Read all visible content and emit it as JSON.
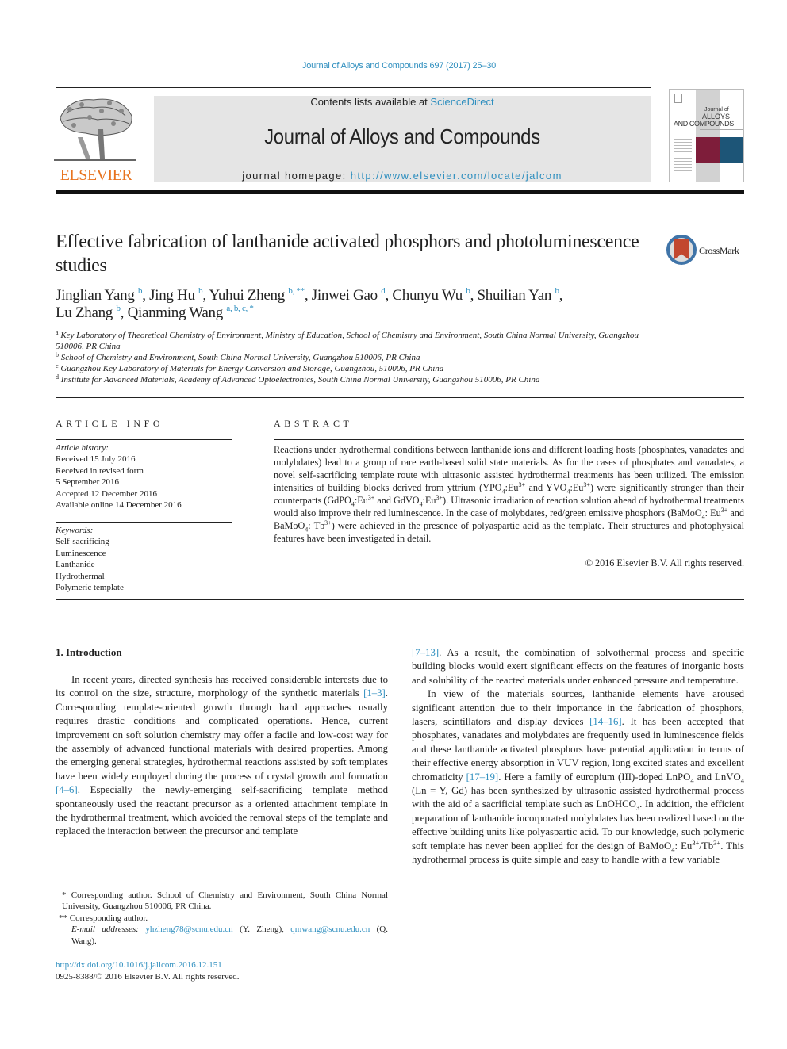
{
  "header": {
    "citation": "Journal of Alloys and Compounds 697 (2017) 25–30",
    "contents_prefix": "Contents lists available at ",
    "contents_link": "ScienceDirect",
    "journal_title": "Journal of Alloys and Compounds",
    "homepage_prefix": "journal homepage: ",
    "homepage_link": "http://www.elsevier.com/locate/jalcom",
    "publisher_logo_text": "ELSEVIER",
    "cover": {
      "title_line1": "Journal of",
      "title_line2": "ALLOYS",
      "title_line3": "AND COMPOUNDS"
    },
    "brand_colors": {
      "link": "#2f8fbf",
      "elsevier_orange": "#e8731e",
      "cover_red": "#7e1d3a",
      "cover_blue": "#1d5577"
    }
  },
  "article": {
    "title": "Effective fabrication of lanthanide activated phosphors and photoluminescence studies",
    "crossmark_label": "CrossMark",
    "authors": [
      {
        "name": "Jinglian Yang",
        "marks": "b"
      },
      {
        "name": "Jing Hu",
        "marks": "b"
      },
      {
        "name": "Yuhui Zheng",
        "marks": "b, **"
      },
      {
        "name": "Jinwei Gao",
        "marks": "d"
      },
      {
        "name": "Chunyu Wu",
        "marks": "b"
      },
      {
        "name": "Shuilian Yan",
        "marks": "b"
      },
      {
        "name": "Lu Zhang",
        "marks": "b"
      },
      {
        "name": "Qianming Wang",
        "marks": "a, b, c, *"
      }
    ],
    "affiliations": [
      {
        "mark": "a",
        "text": "Key Laboratory of Theoretical Chemistry of Environment, Ministry of Education, School of Chemistry and Environment, South China Normal University, Guangzhou 510006, PR China"
      },
      {
        "mark": "b",
        "text": "School of Chemistry and Environment, South China Normal University, Guangzhou 510006, PR China"
      },
      {
        "mark": "c",
        "text": "Guangzhou Key Laboratory of Materials for Energy Conversion and Storage, Guangzhou, 510006, PR China"
      },
      {
        "mark": "d",
        "text": "Institute for Advanced Materials, Academy of Advanced Optoelectronics, South China Normal University, Guangzhou 510006, PR China"
      }
    ]
  },
  "article_info": {
    "heading": "ARTICLE INFO",
    "history_label": "Article history:",
    "history": [
      "Received 15 July 2016",
      "Received in revised form",
      "5 September 2016",
      "Accepted 12 December 2016",
      "Available online 14 December 2016"
    ],
    "keywords_label": "Keywords:",
    "keywords": [
      "Self-sacrificing",
      "Luminescence",
      "Lanthanide",
      "Hydrothermal",
      "Polymeric template"
    ]
  },
  "abstract": {
    "heading": "ABSTRACT",
    "s1": "Reactions under hydrothermal conditions between lanthanide ions and different loading hosts (phosphates, vanadates and molybdates) lead to a group of rare earth-based solid state materials. As for the cases of phosphates and vanadates, a novel self-sacrificing template route with ultrasonic assisted hydrothermal treatments has been utilized. The emission intensities of building blocks derived from yttrium (YPO",
    "s2": ":Eu",
    "s3": " and YVO",
    "s4": ":Eu",
    "s5": ") were significantly stronger than their counterparts (GdPO",
    "s6": ":Eu",
    "s7": " and GdVO",
    "s8": ":Eu",
    "s9": "). Ultrasonic irradiation of reaction solution ahead of hydrothermal treatments would also improve their red luminescence. In the case of molybdates, red/green emissive phosphors (BaMoO",
    "s10": ": Eu",
    "s11": " and BaMoO",
    "s12": ": Tb",
    "s13": ") were achieved in the presence of polyaspartic acid as the template. Their structures and photophysical features have been investigated in detail.",
    "sub4": "4",
    "sup3": "3+",
    "copyright": "© 2016 Elsevier B.V. All rights reserved."
  },
  "body": {
    "intro_heading": "1.  Introduction",
    "p1_a": "In recent years, directed synthesis has received considerable interests due to its control on the size, structure, morphology of the synthetic materials ",
    "p1_ref1": "[1–3]",
    "p1_b": ". Corresponding template-oriented growth through hard approaches usually requires drastic conditions and complicated operations. Hence, current improvement on soft solution chemistry may offer a facile and low-cost way for the assembly of advanced functional materials with desired properties. Among the emerging general strategies, hydrothermal reactions assisted by soft templates have been widely employed during the process of crystal growth and formation ",
    "p1_ref2": "[4–6]",
    "p1_c": ". Especially the newly-emerging self-sacrificing template method spontaneously used the reactant precursor as a oriented attachment template in the hydrothermal treatment, which avoided the removal steps of the template and replaced the interaction between the precursor and template ",
    "p1_ref3": "[7–13]",
    "p1_d": ". As a result, the combination of solvothermal process and specific building blocks would exert significant effects on the features of inorganic hosts and solubility of the reacted materials under enhanced pressure and temperature.",
    "p2_a": "In view of the materials sources, lanthanide elements have aroused significant attention due to their importance in the fabrication of phosphors, lasers, scintillators and display devices ",
    "p2_ref1": "[14–16]",
    "p2_b": ". It has been accepted that phosphates, vanadates and molybdates are frequently used in luminescence fields and these lanthanide activated phosphors have potential application in terms of their effective energy absorption in VUV region, long excited states and excellent chromaticity ",
    "p2_ref2": "[17–19]",
    "p2_c": ". Here a family of europium (III)-doped LnPO",
    "p2_d": " and LnVO",
    "p2_e": " (Ln = Y, Gd) has been synthesized by ultrasonic assisted hydrothermal process with the aid of a sacrificial template such as LnOHCO",
    "p2_f": ". In addition, the efficient preparation of lanthanide incorporated molybdates has been realized based on the effective building units like polyaspartic acid. To our knowledge, such polymeric soft template has never been applied for the design of BaMoO",
    "p2_g": ": Eu",
    "p2_h": "/Tb",
    "p2_i": ". This hydrothermal process is quite simple and easy to handle with a few variable",
    "sub3": "3"
  },
  "footnotes": {
    "star1": "* Corresponding author. School of Chemistry and Environment, South China Normal University, Guangzhou 510006, PR China.",
    "star2": "** Corresponding author.",
    "email_label": "E-mail addresses: ",
    "email1": "yhzheng78@scnu.edu.cn",
    "email1_who": " (Y. Zheng), ",
    "email2": "qmwang@scnu.edu.cn",
    "email2_who": " (Q. Wang).",
    "doi": "http://dx.doi.org/10.1016/j.jallcom.2016.12.151",
    "issn_line": "0925-8388/© 2016 Elsevier B.V. All rights reserved."
  }
}
